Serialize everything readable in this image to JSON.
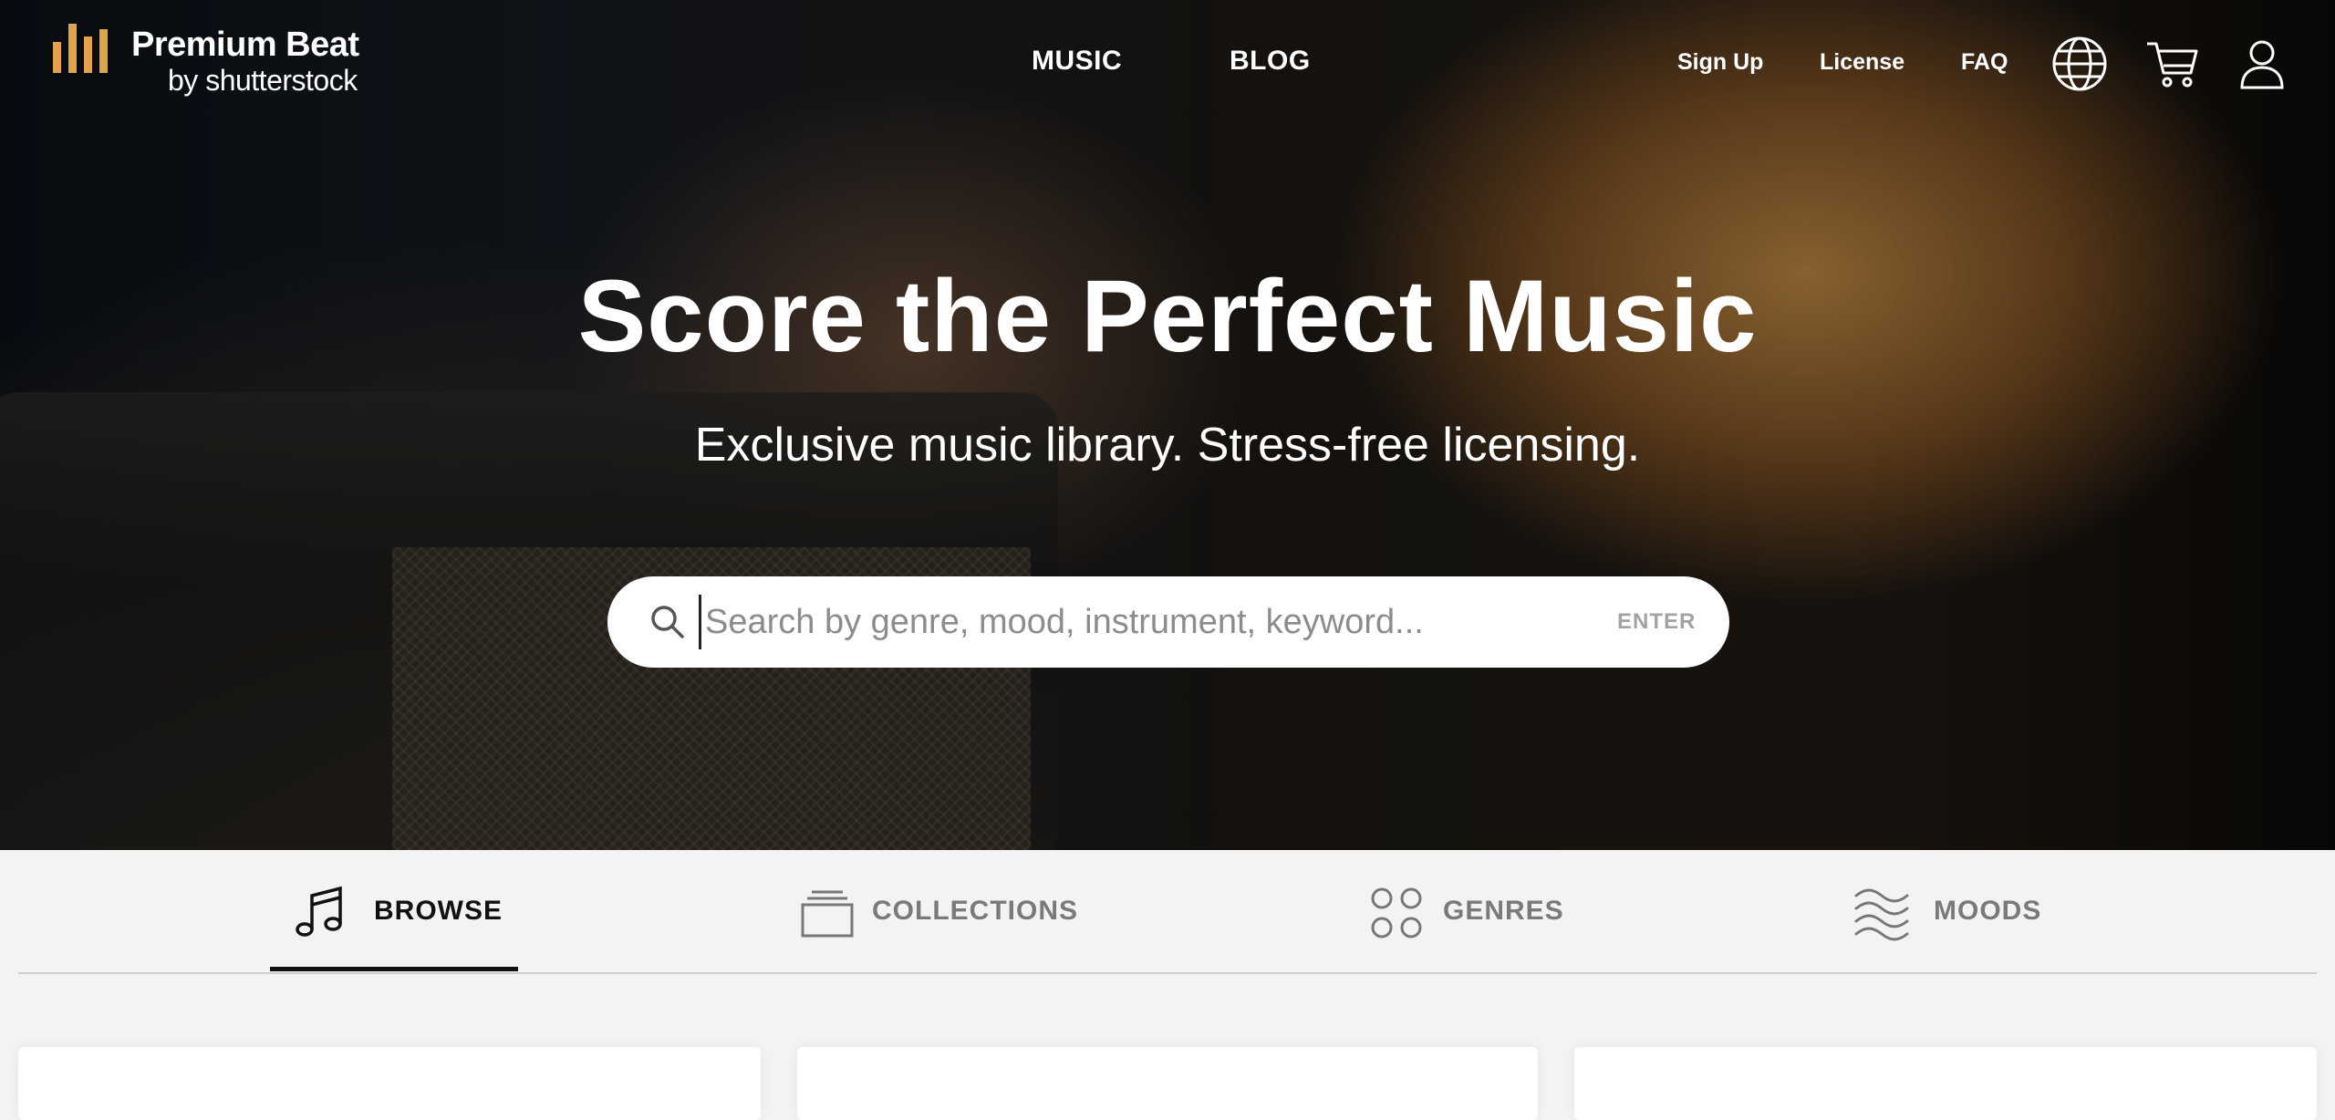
{
  "brand": {
    "name": "Premium Beat",
    "byline": "by shutterstock"
  },
  "nav": {
    "main": [
      "MUSIC",
      "BLOG"
    ],
    "secondary": [
      "Sign Up",
      "License",
      "FAQ"
    ],
    "icons": [
      "globe-icon",
      "cart-icon",
      "user-icon"
    ]
  },
  "hero": {
    "headline": "Score the Perfect Music",
    "subhead": "Exclusive music library. Stress-free licensing.",
    "search_placeholder": "Search by genre, mood, instrument, keyword...",
    "search_action": "ENTER"
  },
  "tabs": [
    {
      "label": "BROWSE",
      "icon": "music-note-icon",
      "active": true
    },
    {
      "label": "COLLECTIONS",
      "icon": "collections-icon",
      "active": false
    },
    {
      "label": "GENRES",
      "icon": "genres-icon",
      "active": false
    },
    {
      "label": "MOODS",
      "icon": "moods-icon",
      "active": false
    }
  ],
  "colors": {
    "accent": "#e2a34d",
    "active_tab": "#111111",
    "inactive_tab": "#7a7a7a",
    "panel_bg": "#f3f3f3"
  }
}
